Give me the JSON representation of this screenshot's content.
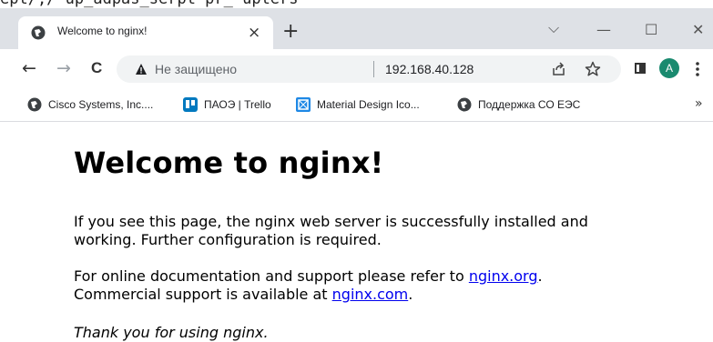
{
  "clipped_top_text": "ept/,/ up_adpas_serpt pr_ upters",
  "tab": {
    "title": "Welcome to nginx!",
    "close": "×",
    "new_tab": "+"
  },
  "window_controls": {
    "chevron": "⌵",
    "minimize": "—",
    "maximize": "☐",
    "close": "✕"
  },
  "toolbar": {
    "back": "←",
    "forward": "→",
    "reload": "C",
    "security_text": "Не защищено",
    "url": "192.168.40.128",
    "avatar_letter": "A"
  },
  "bookmarks": [
    {
      "label": "Cisco Systems, Inc....",
      "icon": "globe-icon"
    },
    {
      "label": "ПАОЭ | Trello",
      "icon": "trello-icon"
    },
    {
      "label": "Material Design Ico...",
      "icon": "material-icon"
    },
    {
      "label": "Поддержка СО ЕЭС",
      "icon": "globe-icon"
    }
  ],
  "bookmarks_more": "»",
  "page": {
    "heading": "Welcome to nginx!",
    "p1_line1": "If you see this page, the nginx web server is successfully installed and",
    "p1_line2": "working. Further configuration is required.",
    "p2_line1_prefix": "For online documentation and support please refer to ",
    "p2_link1": "nginx.org",
    "p2_line1_suffix": ".",
    "p2_line2_prefix": "Commercial support is available at ",
    "p2_link2": "nginx.com",
    "p2_line2_suffix": ".",
    "thanks": "Thank you for using nginx."
  },
  "colors": {
    "titlebar": "#dee1e6",
    "avatar": "#1a8a6f",
    "link": "#0000ee",
    "trello": "#0079bf",
    "material": "#1e88e5"
  }
}
